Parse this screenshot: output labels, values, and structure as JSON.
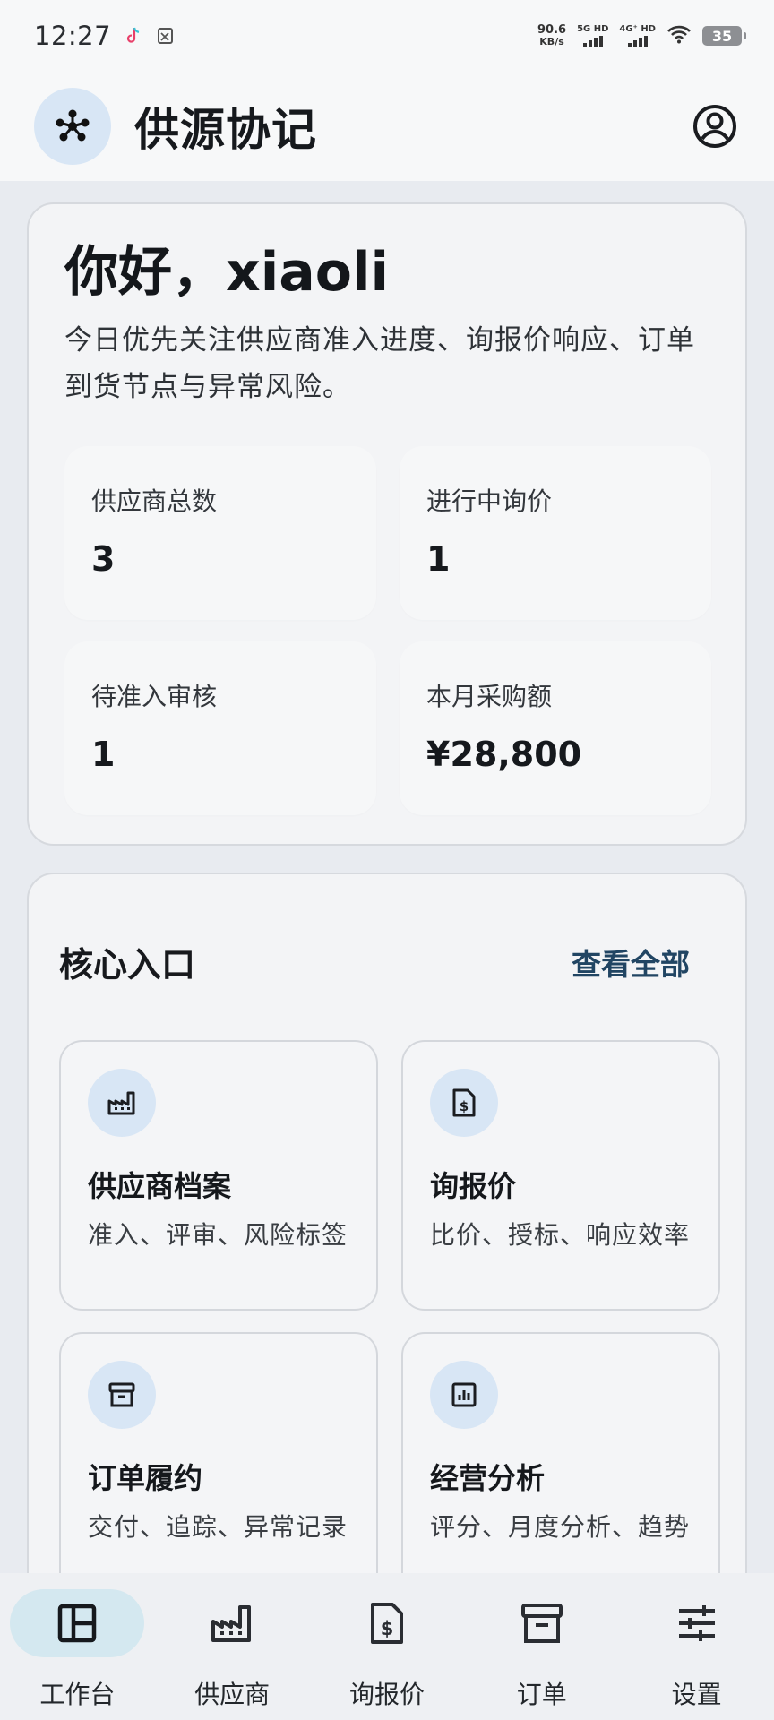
{
  "status_bar": {
    "time": "12:27",
    "speed_value": "90.6",
    "speed_unit": "KB/s",
    "net1": "5G HD",
    "net2": "4G⁺ HD",
    "battery": "35"
  },
  "app_bar": {
    "title": "供源协记",
    "logo_icon": "network-hub-icon",
    "profile_icon": "account-circle-icon"
  },
  "hero": {
    "greeting": "你好，xiaoli",
    "description": "今日优先关注供应商准入进度、询报价响应、订单到货节点与异常风险。",
    "stats": [
      {
        "label": "供应商总数",
        "value": "3"
      },
      {
        "label": "进行中询价",
        "value": "1"
      },
      {
        "label": "待准入审核",
        "value": "1"
      },
      {
        "label": "本月采购额",
        "value": "¥28,800"
      }
    ]
  },
  "entry": {
    "title": "核心入口",
    "view_all": "查看全部",
    "tiles": [
      {
        "title": "供应商档案",
        "desc": "准入、评审、风险标签",
        "icon": "factory-icon"
      },
      {
        "title": "询报价",
        "desc": "比价、授标、响应效率",
        "icon": "price-document-icon"
      },
      {
        "title": "订单履约",
        "desc": "交付、追踪、异常记录",
        "icon": "archive-box-icon"
      },
      {
        "title": "经营分析",
        "desc": "评分、月度分析、趋势",
        "icon": "bar-chart-icon"
      }
    ]
  },
  "bottom_nav": {
    "items": [
      {
        "label": "工作台",
        "icon": "dashboard-icon",
        "active": true
      },
      {
        "label": "供应商",
        "icon": "factory-icon",
        "active": false
      },
      {
        "label": "询报价",
        "icon": "price-document-icon",
        "active": false
      },
      {
        "label": "订单",
        "icon": "archive-box-icon",
        "active": false
      },
      {
        "label": "设置",
        "icon": "sliders-icon",
        "active": false
      }
    ]
  }
}
